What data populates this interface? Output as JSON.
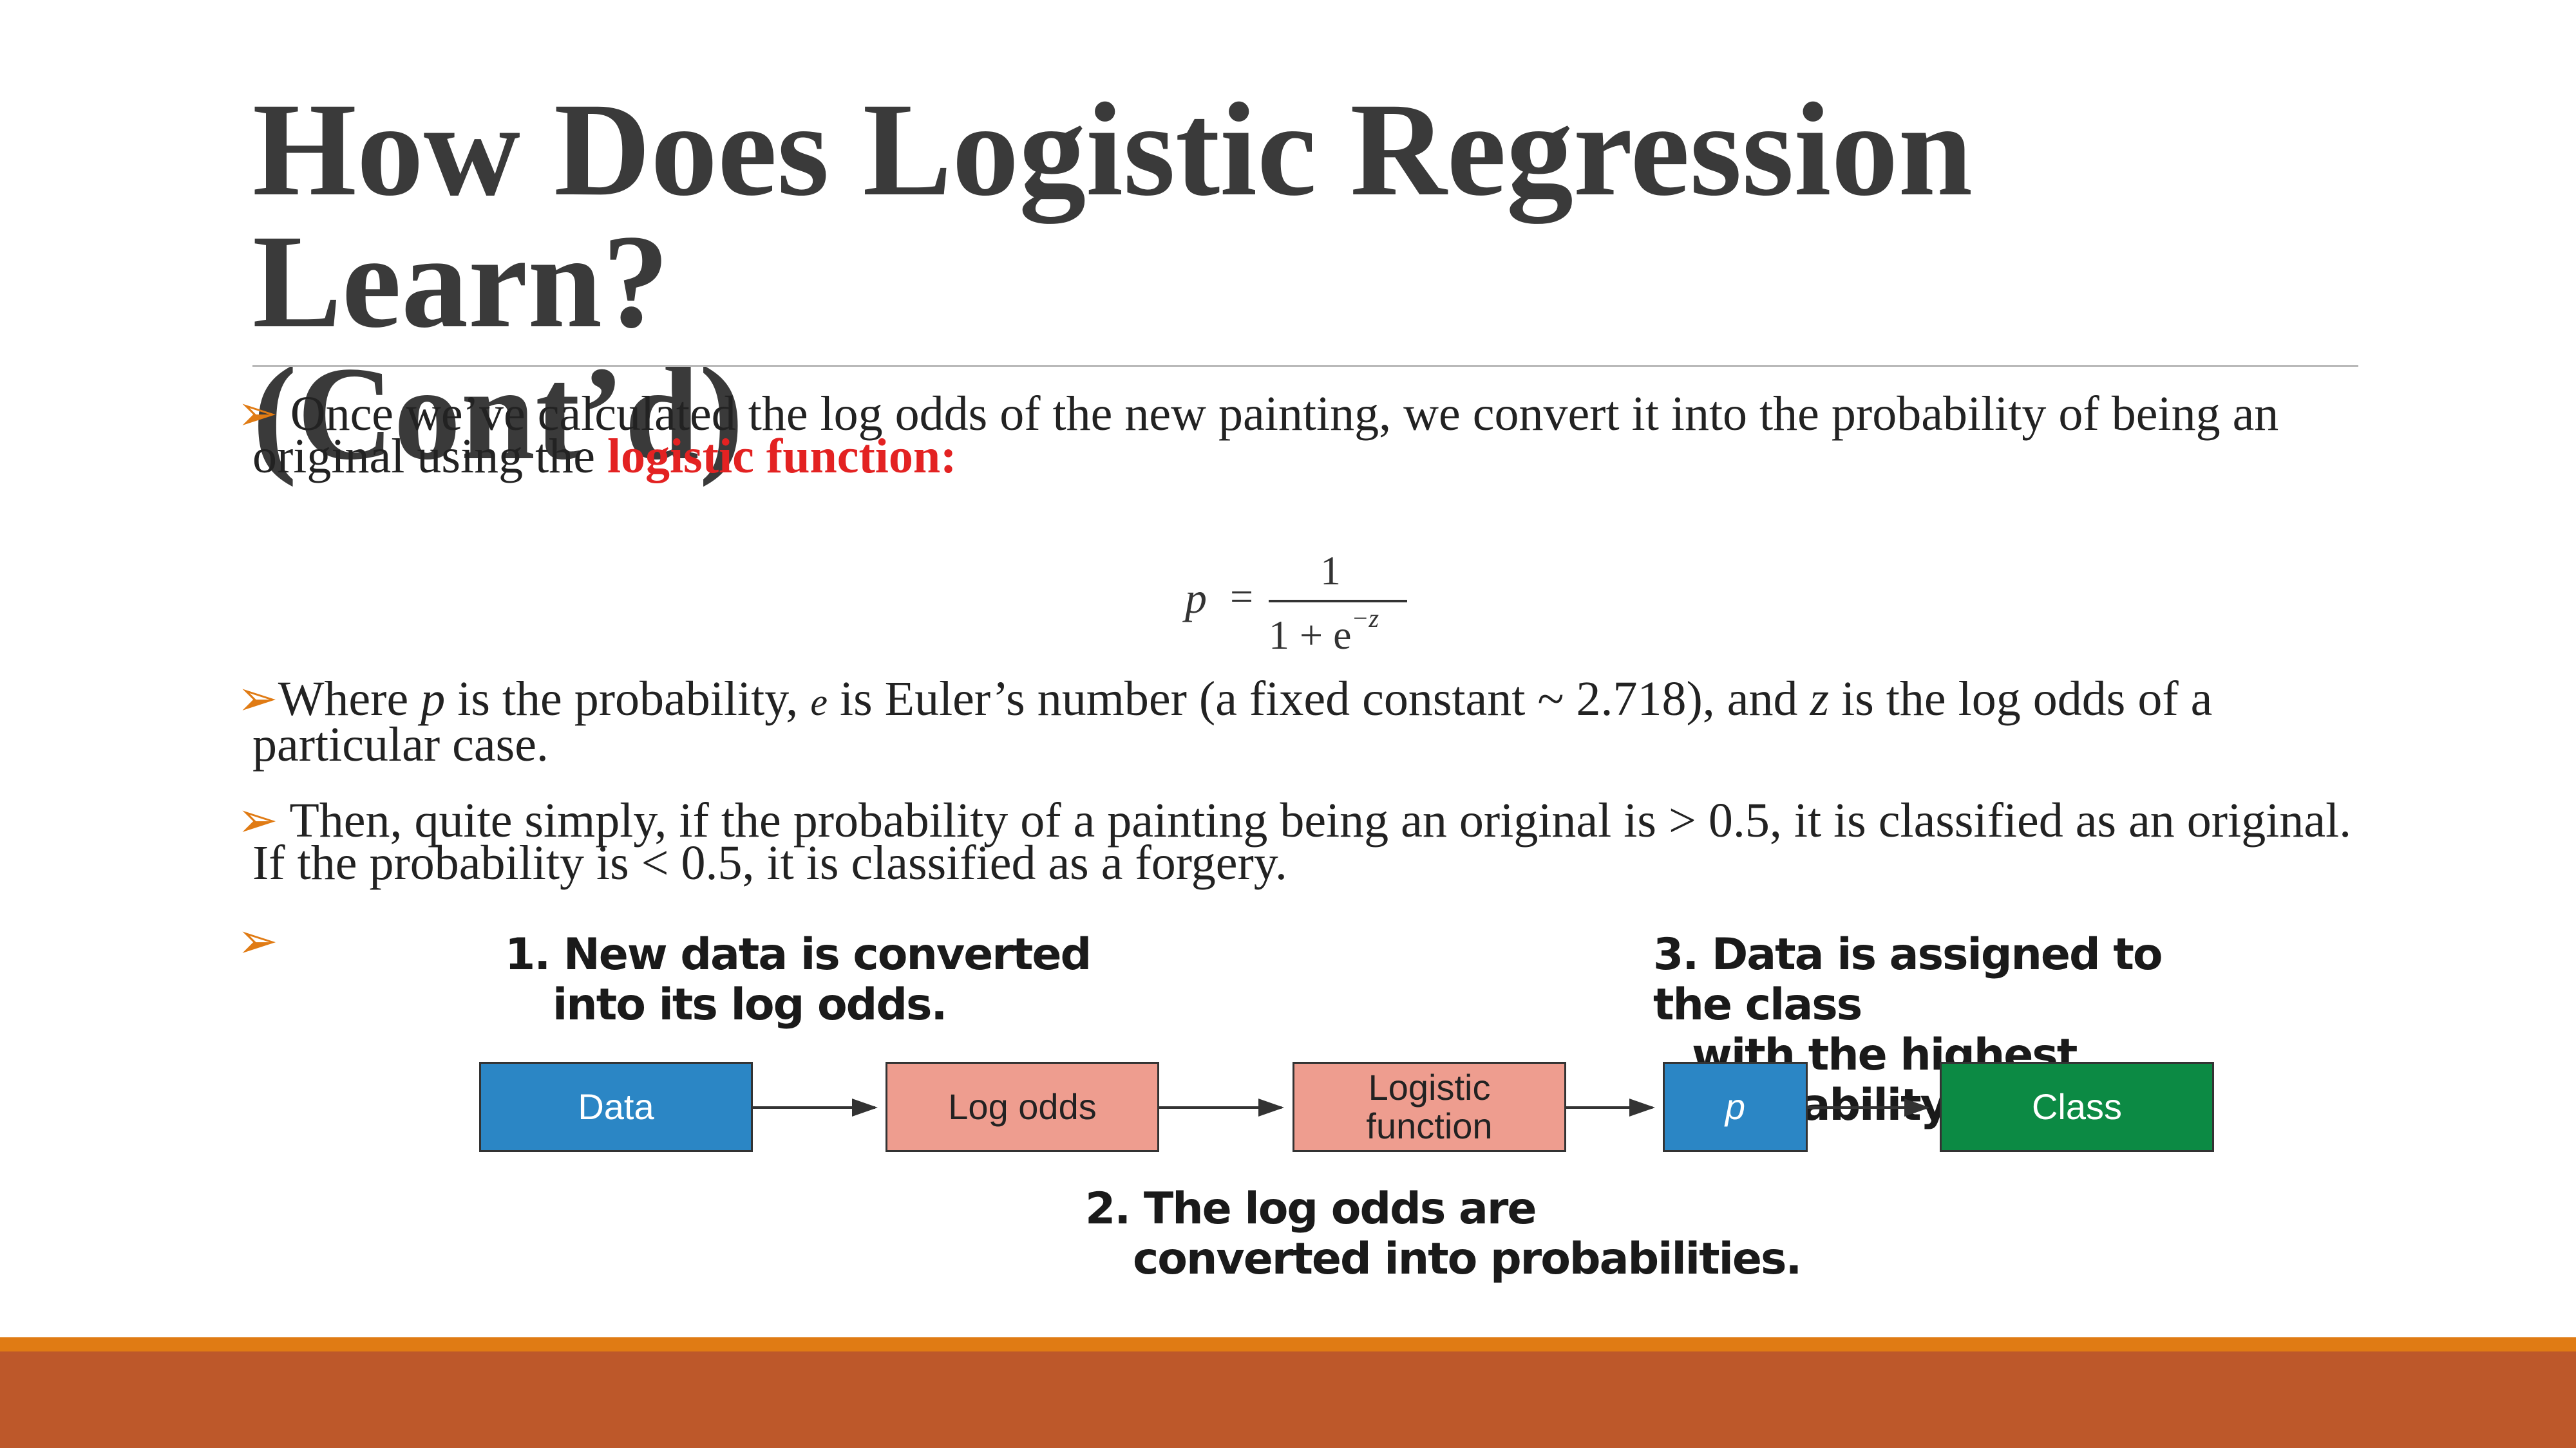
{
  "slide": {
    "title_line1": "How Does Logistic Regression Learn?",
    "title_line2": "(Cont’d)"
  },
  "bullets": {
    "marker": "➢",
    "b1": {
      "line1": " Once we’ve calculated the log odds of the new painting, we convert it into the probability of being an",
      "line2_start": "original using the ",
      "highlight": "logistic function:"
    },
    "formula": {
      "variable": "p",
      "equals": "=",
      "numerator": "1",
      "denominator_base": "1 + e",
      "denominator_exp": "−z"
    },
    "b2": {
      "t1": "Where ",
      "p": "p",
      "t2": " is the probability, ",
      "e": "e",
      "t3": " is Euler’s number (a fixed constant ~ 2.718), and ",
      "z": "z",
      "t4": " is the log odds of a",
      "line2": "particular case."
    },
    "b3": {
      "line1": " Then, quite simply, if the probability of a painting being an original is > 0.5, it is classified as an original.",
      "line2": "If the probability is < 0.5, it is classified as a forgery."
    }
  },
  "diagram": {
    "step1": [
      "1. New data is converted",
      "into its log odds."
    ],
    "step2": [
      "2. The log odds are",
      "converted into probabilities."
    ],
    "step3": [
      "3. Data is assigned to the class",
      "with the highest probability."
    ],
    "boxes": {
      "data": [
        "Data"
      ],
      "log_odds": [
        "Log odds"
      ],
      "logistic": [
        "Logistic",
        "function"
      ],
      "p": [
        "p"
      ],
      "class": [
        "Class"
      ]
    },
    "colors": {
      "data": "#2b86c5",
      "log_odds": "#ee9d8f",
      "logistic": "#ee9d8f",
      "p": "#2b86c5",
      "class": "#0c8a44"
    }
  },
  "theme": {
    "accent_orange": "#e07b14",
    "footer_rust": "#bd582a",
    "highlight_red": "#e32222"
  }
}
